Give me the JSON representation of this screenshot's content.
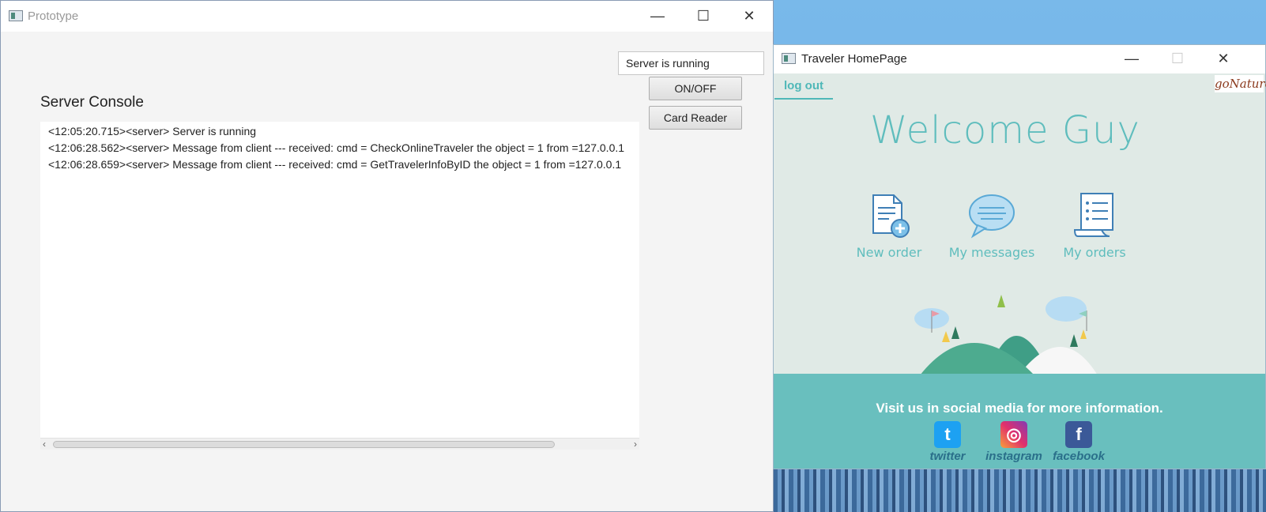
{
  "prototype_window": {
    "title": "Prototype",
    "server_status": "Server is running",
    "on_off_label": "ON/OFF",
    "card_reader_label": "Card Reader",
    "console_title": "Server Console",
    "console_lines": [
      "<12:05:20.715><server> Server is running",
      "<12:06:28.562><server> Message from client --- received: cmd = CheckOnlineTraveler the object = 1 from =127.0.0.1",
      "<12:06:28.659><server> Message from client --- received: cmd = GetTravelerInfoByID the object = 1 from =127.0.0.1"
    ]
  },
  "traveler_window": {
    "title": "Traveler HomePage",
    "logout_label": "log out",
    "brand": "goNature",
    "welcome_word": "Welcome",
    "user_name": "Guy",
    "tiles": [
      {
        "label": "New order",
        "icon": "new-order-icon"
      },
      {
        "label": "My messages",
        "icon": "messages-icon"
      },
      {
        "label": "My orders",
        "icon": "orders-icon"
      }
    ],
    "footer_text": "Visit us in social media for more information.",
    "social": [
      {
        "label": "twitter",
        "color": "#1da1f2"
      },
      {
        "label": "instagram",
        "color": "#c13584"
      },
      {
        "label": "facebook",
        "color": "#3b5998"
      }
    ]
  },
  "colors": {
    "accent": "#5fbdbd",
    "footer": "#69bfbe"
  }
}
